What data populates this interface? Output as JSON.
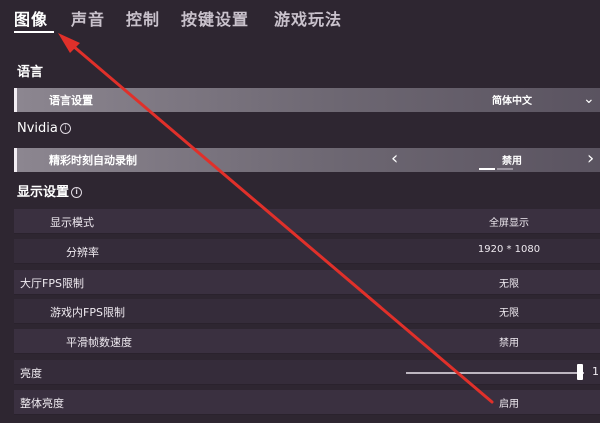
{
  "tabs": [
    "图像",
    "声音",
    "控制",
    "按键设置",
    "游戏玩法"
  ],
  "language_section": {
    "title": "语言",
    "setting_label": "语言设置",
    "setting_value": "简体中文"
  },
  "nvidia": {
    "title": "Nvidia",
    "highlight_label": "精彩时刻自动录制",
    "highlight_value": "禁用"
  },
  "display_section": {
    "title": "显示设置",
    "rows": [
      {
        "label": "显示模式",
        "value": "全屏显示"
      },
      {
        "label": "分辨率",
        "value": "1920 * 1080"
      },
      {
        "label": "大厅FPS限制",
        "value": "无限"
      },
      {
        "label": "游戏内FPS限制",
        "value": "无限"
      },
      {
        "label": "平滑帧数速度",
        "value": "禁用"
      },
      {
        "label": "亮度",
        "value": "1"
      },
      {
        "label": "整体亮度",
        "value": "启用"
      }
    ],
    "brightness_level": 0.98
  },
  "info_glyph": "i",
  "colors": {
    "annotation_arrow": "#e0302a"
  }
}
